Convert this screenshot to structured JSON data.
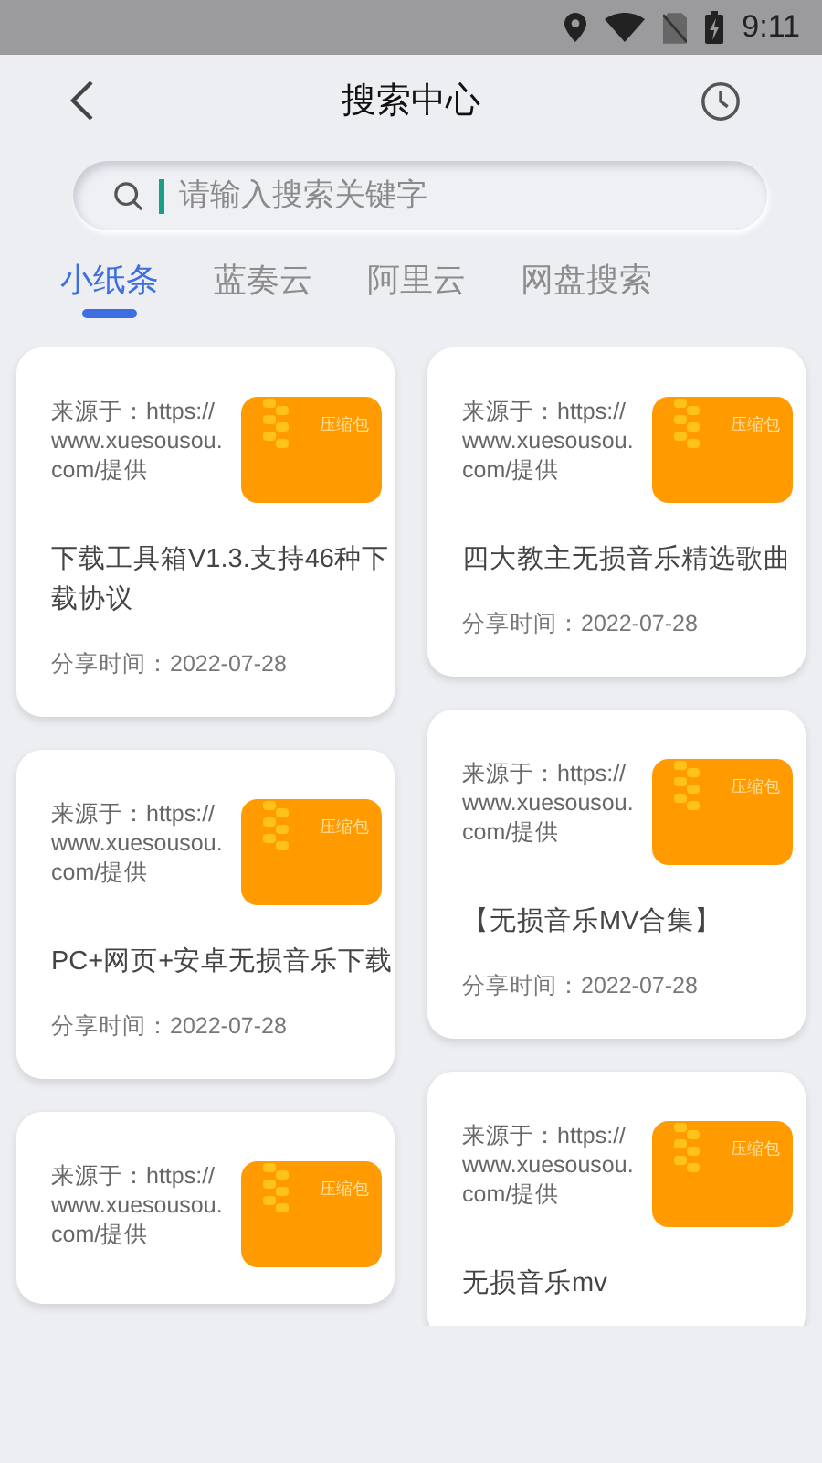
{
  "status_bar": {
    "time": "9:11"
  },
  "header": {
    "title": "搜索中心"
  },
  "search": {
    "placeholder": "请输入搜索关键字"
  },
  "tabs": [
    {
      "label": "小纸条",
      "selected": true
    },
    {
      "label": "蓝奏云",
      "selected": false
    },
    {
      "label": "阿里云",
      "selected": false
    },
    {
      "label": "网盘搜索",
      "selected": false
    }
  ],
  "columns": [
    [
      {
        "source": "来源于：https://www.xuesousou.com/提供",
        "badge": "压缩包",
        "title": "下载工具箱V1.3.支持46种下载协议",
        "date": "分享时间：2022-07-28"
      },
      {
        "source": "来源于：https://www.xuesousou.com/提供",
        "badge": "压缩包",
        "title": "PC+网页+安卓无损音乐下载",
        "date": "分享时间：2022-07-28"
      },
      {
        "source": "来源于：https://www.xuesousou.com/提供",
        "badge": "压缩包"
      }
    ],
    [
      {
        "source": "来源于：https://www.xuesousou.com/提供",
        "badge": "压缩包",
        "title": "四大教主无损音乐精选歌曲",
        "date": "分享时间：2022-07-28"
      },
      {
        "source": "来源于：https://www.xuesousou.com/提供",
        "badge": "压缩包",
        "title": "【无损音乐MV合集】",
        "date": "分享时间：2022-07-28"
      },
      {
        "source": "来源于：https://www.xuesousou.com/提供",
        "badge": "压缩包",
        "title": "无损音乐mv"
      }
    ]
  ]
}
